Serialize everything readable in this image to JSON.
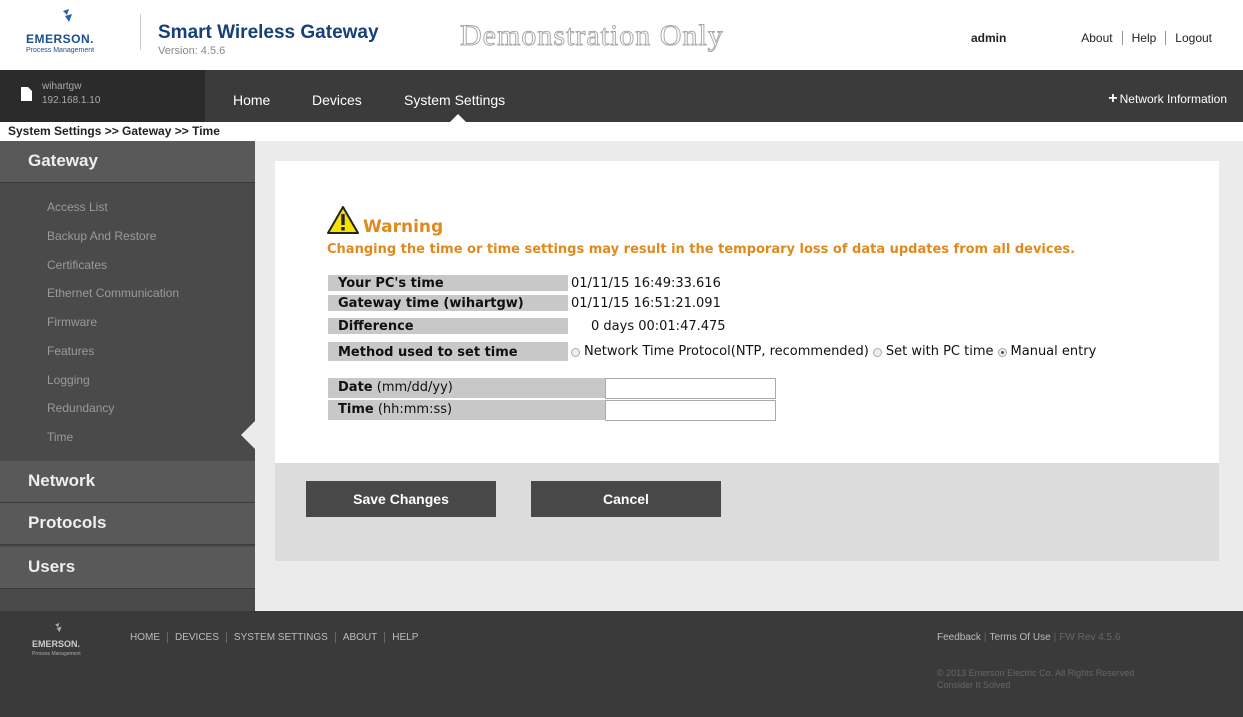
{
  "header": {
    "brand": "EMERSON.",
    "brand_sub": "Process Management",
    "title": "Smart Wireless Gateway",
    "version": "Version: 4.5.6",
    "demo_banner": "Demonstration Only",
    "user": "admin",
    "links": [
      "About",
      "Help",
      "Logout"
    ]
  },
  "nav": {
    "gateway_name": "wihartgw",
    "gateway_ip": "192.168.1.10",
    "items": [
      "Home",
      "Devices",
      "System Settings"
    ],
    "network_info": "Network Information"
  },
  "breadcrumb": "System Settings >> Gateway >> Time",
  "sidebar": {
    "sections": [
      "Gateway",
      "Network",
      "Protocols",
      "Users"
    ],
    "gateway_items": [
      "Access List",
      "Backup And Restore",
      "Certificates",
      "Ethernet Communication",
      "Firmware",
      "Features",
      "Logging",
      "Redundancy",
      "Time"
    ]
  },
  "main": {
    "warning_title": "Warning",
    "warning_message": "Changing the time or time settings may result in the temporary loss of data updates from all devices.",
    "rows": [
      {
        "label": "Your PC's time",
        "value": "01/11/15 16:49:33.616"
      },
      {
        "label": "Gateway time (wihartgw)",
        "value": "01/11/15 16:51:21.091"
      },
      {
        "label": "Difference",
        "value": "0 days 00:01:47.475"
      }
    ],
    "method_label": "Method used to set time",
    "method_options": [
      "Network Time Protocol(NTP, recommended)",
      "Set with PC time",
      "Manual entry"
    ],
    "method_selected": "Manual entry",
    "date_label": "Date",
    "date_hint": "(mm/dd/yy)",
    "date_value": "",
    "time_label": "Time",
    "time_hint": "(hh:mm:ss)",
    "time_value": "",
    "save_label": "Save Changes",
    "cancel_label": "Cancel"
  },
  "footer": {
    "brand": "EMERSON.",
    "brand_sub": "Process Management",
    "links": [
      "HOME",
      "DEVICES",
      "SYSTEM SETTINGS",
      "ABOUT",
      "HELP"
    ],
    "feedback": "Feedback",
    "terms": "Terms Of Use",
    "fw": "FW Rev 4.5.6",
    "copyright": "© 2013 Emerson Electric Co. All Rights Reserved",
    "tagline": "Consider It Solved"
  },
  "colors": {
    "warning": "#e08a1e",
    "nav_bg": "#3b3b3b",
    "sidebar_bg": "#4a4a4a",
    "button_bg": "#484848",
    "title_blue": "#173f78"
  }
}
